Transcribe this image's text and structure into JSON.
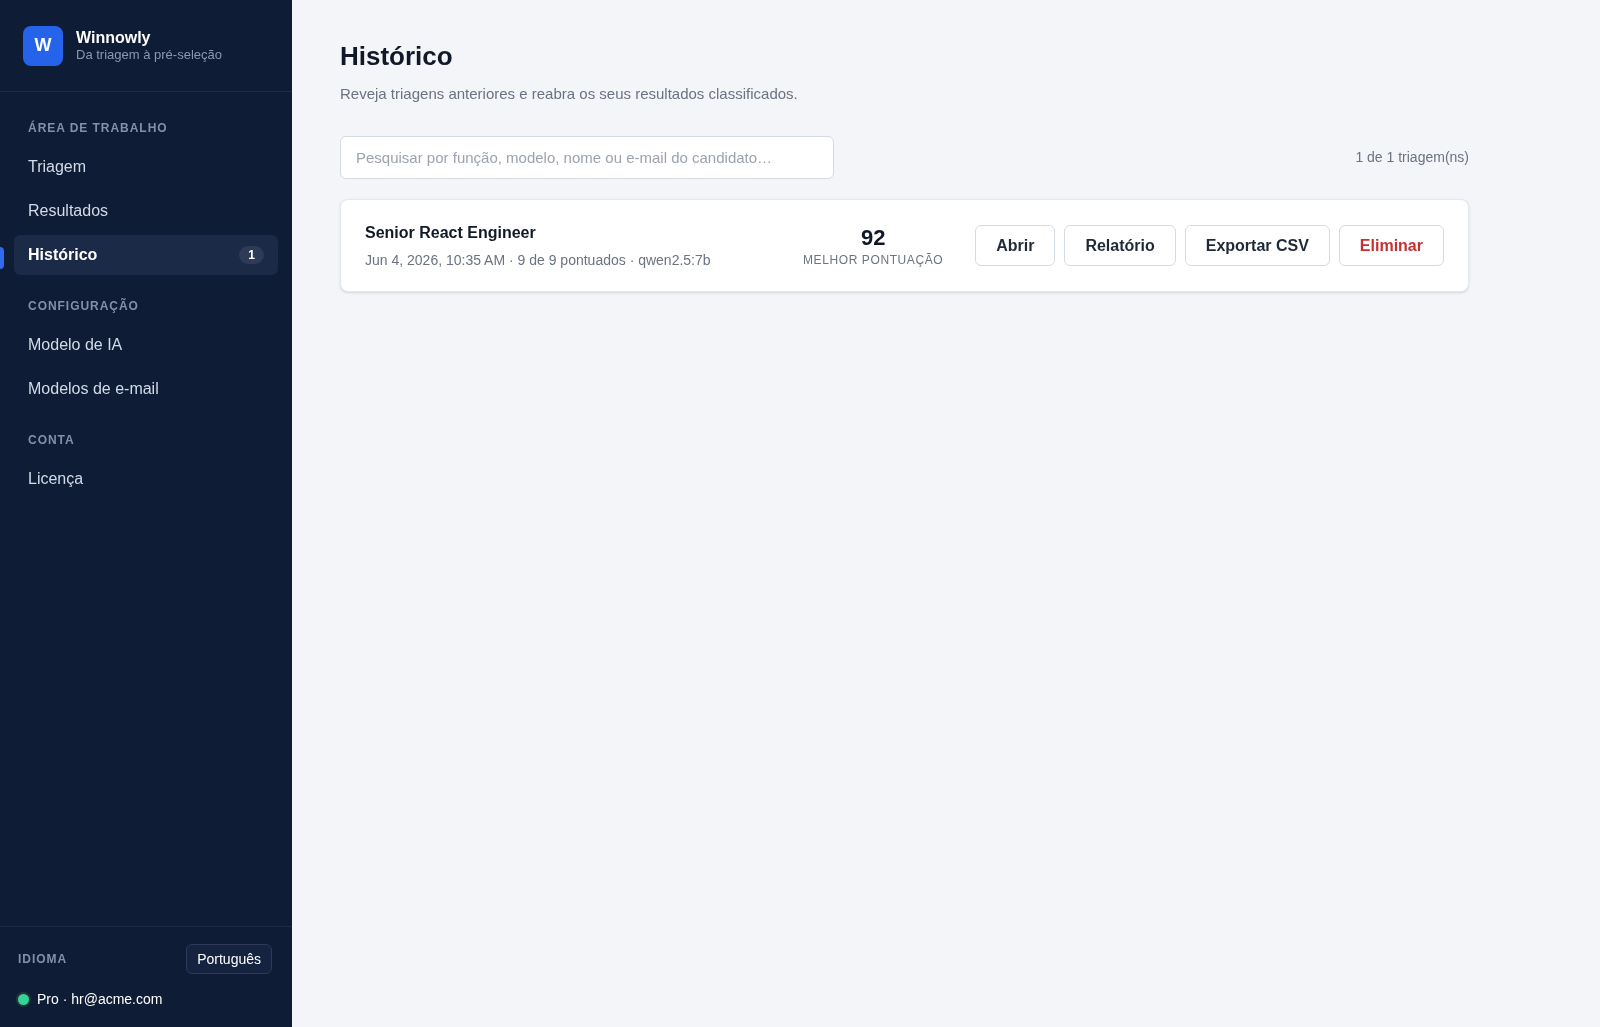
{
  "sidebar": {
    "brand": {
      "logo": "W",
      "name": "Winnowly",
      "tagline": "Da triagem à pré-seleção"
    },
    "sections": [
      {
        "title": "ÁREA DE TRABALHO",
        "items": [
          {
            "label": "Triagem",
            "selected": false
          },
          {
            "label": "Resultados",
            "selected": false
          },
          {
            "label": "Histórico",
            "selected": true,
            "badge": "1"
          }
        ]
      },
      {
        "title": "CONFIGURAÇÃO",
        "items": [
          {
            "label": "Modelo de IA",
            "selected": false
          },
          {
            "label": "Modelos de e-mail",
            "selected": false
          }
        ]
      },
      {
        "title": "CONTA",
        "items": [
          {
            "label": "Licença",
            "selected": false
          }
        ]
      }
    ],
    "footer": {
      "language_label": "IDIOMA",
      "language_button": "Português",
      "account": {
        "color": "#34d399",
        "text": "Pro · hr@acme.com"
      }
    }
  },
  "page": {
    "title": "Histórico",
    "subtitle": "Reveja triagens anteriores e reabra os seus resultados classificados.",
    "search": {
      "placeholder": "Pesquisar por função, modelo, nome ou e-mail do candidato…"
    },
    "count": "1 de 1 triagem(ns)",
    "runs": [
      {
        "title": "Senior React Engineer",
        "meta": "Jun 4, 2026, 10:35 AM · 9 de 9 pontuados · qwen2.5:7b",
        "score": "92",
        "score_label": "MELHOR PONTUAÇÃO",
        "actions": [
          {
            "label": "Abrir",
            "kind": "default"
          },
          {
            "label": "Relatório",
            "kind": "default"
          },
          {
            "label": "Exportar CSV",
            "kind": "default"
          },
          {
            "label": "Eliminar",
            "kind": "danger"
          }
        ]
      }
    ]
  }
}
